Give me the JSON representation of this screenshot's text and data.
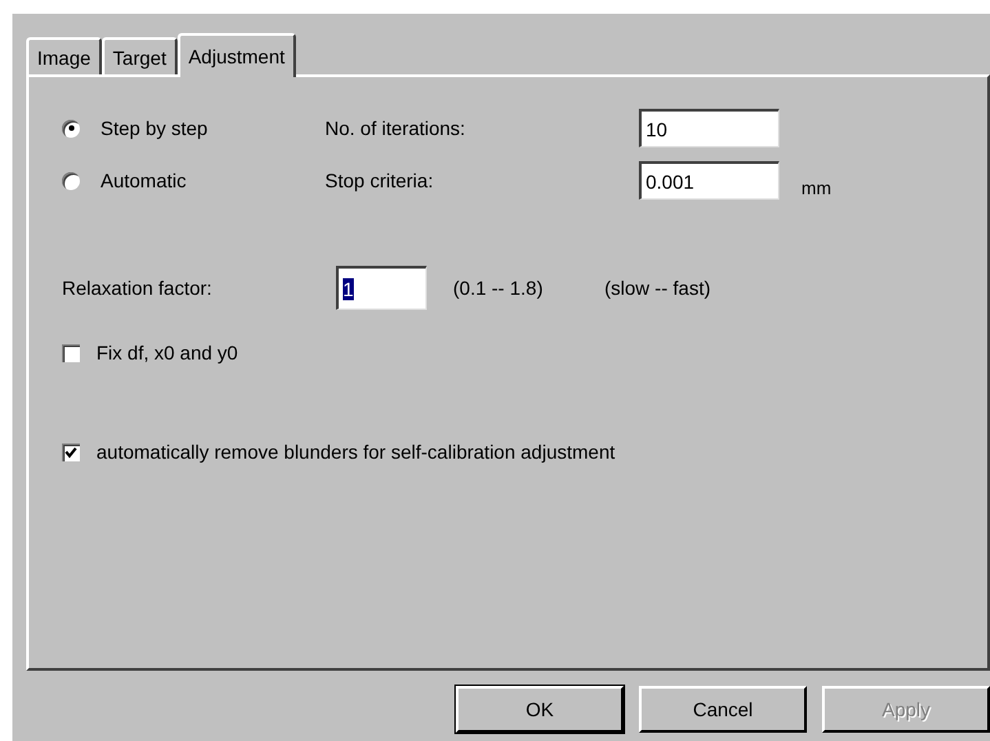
{
  "tabs": [
    {
      "label": "Image",
      "selected": false
    },
    {
      "label": "Target",
      "selected": false
    },
    {
      "label": "Adjustment",
      "selected": true
    }
  ],
  "modes": [
    {
      "label": "Step by step",
      "selected": true,
      "field_label": "No. of iterations:",
      "value": "10"
    },
    {
      "label": "Automatic",
      "selected": false,
      "field_label": "Stop criteria:",
      "value": "0.001",
      "unit": "mm"
    }
  ],
  "relaxation": {
    "label": "Relaxation factor:",
    "value": "1",
    "text_selected": true,
    "range": "(0.1 -- 1.8)",
    "hint": "(slow -- fast)"
  },
  "checkboxes": [
    {
      "label": "Fix df, x0 and y0",
      "checked": false
    },
    {
      "label": "automatically remove blunders for self-calibration adjustment",
      "checked": true
    }
  ],
  "buttons": [
    {
      "label": "OK",
      "disabled": false
    },
    {
      "label": "Cancel",
      "disabled": false
    },
    {
      "label": "Apply",
      "disabled": true
    }
  ]
}
